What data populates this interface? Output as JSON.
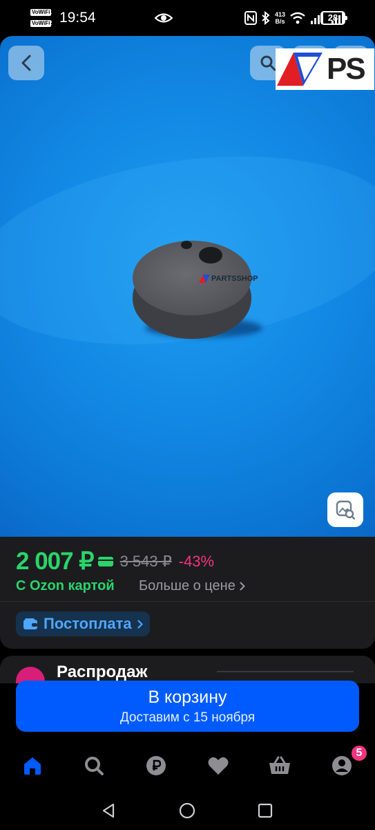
{
  "status_bar": {
    "vowifi1": "VoWiFi",
    "vowifi1_num": "1",
    "vowifi2": "VoWiFi",
    "vowifi2_num": "2",
    "time": "19:54",
    "net_speed_value": "413",
    "net_speed_unit": "B/s",
    "battery": "28"
  },
  "product_image": {
    "logo_text": "PS",
    "watermark": "PARTSSHOP",
    "colors": {
      "background": "#138be6",
      "logo_red": "#e01e24",
      "logo_blue": "#1f4fd6"
    }
  },
  "price": {
    "current": "2 007 ₽",
    "old": "3 543 ₽",
    "discount": "-43%",
    "ozon_card_label": "С Ozon картой",
    "more_link": "Больше о цене",
    "colors": {
      "green": "#2bd46a",
      "pink": "#f5337f"
    }
  },
  "postpay": {
    "label": "Постоплата"
  },
  "next_card": {
    "title": "Распродаж"
  },
  "cart": {
    "title": "В корзину",
    "subtitle": "Доставим с 15 ноября",
    "color": "#005bff"
  },
  "bottom_nav": {
    "items": [
      "home-icon",
      "search-icon",
      "ruble-icon",
      "heart-icon",
      "basket-icon",
      "profile-icon"
    ],
    "profile_badge": "5"
  },
  "system_nav": [
    "back-icon",
    "home-circle-icon",
    "recents-icon"
  ]
}
